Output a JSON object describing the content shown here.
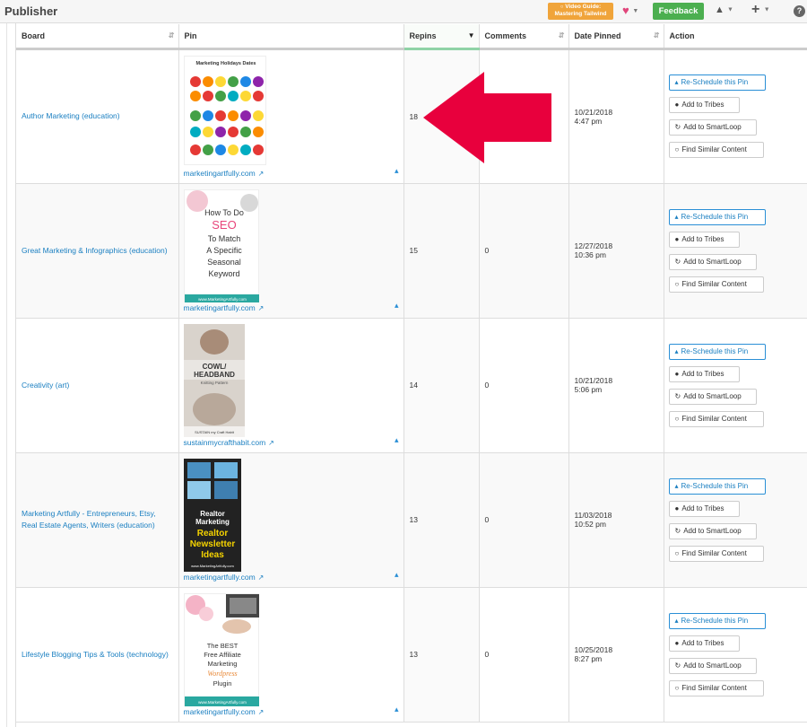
{
  "app": {
    "title": "Publisher",
    "video_guide_line1": "Video Guide:",
    "video_guide_line2": "Mastering Tailwind",
    "feedback_label": "Feedback"
  },
  "table": {
    "headers": {
      "board": "Board",
      "pin": "Pin",
      "repins": "Repins",
      "comments": "Comments",
      "date_pinned": "Date Pinned",
      "action": "Action"
    },
    "sorted_column": "repins",
    "rows": [
      {
        "board": "Author Marketing (education)",
        "domain": "marketingartfully.com",
        "repins": "18",
        "comments": "",
        "date": "10/21/2018",
        "time": "4:47 pm",
        "pin_text": "Marketing Holidays Dates"
      },
      {
        "board": "Great Marketing & Infographics (education)",
        "domain": "marketingartfully.com",
        "repins": "15",
        "comments": "0",
        "date": "12/27/2018",
        "time": "10:36 pm",
        "pin_text": "How To Do SEO To Match A Specific Seasonal Keyword",
        "pin_footer": "www.MarketingArtfully.com"
      },
      {
        "board": "Creativity (art)",
        "domain": "sustainmycrafthabit.com",
        "repins": "14",
        "comments": "0",
        "date": "10/21/2018",
        "time": "5:06 pm",
        "pin_text": "COWL/ HEADBAND",
        "pin_sub": "Knitting Pattern",
        "pin_footer": "SUSTAIN my Craft Habit"
      },
      {
        "board": "Marketing Artfully - Entrepreneurs, Etsy, Real Estate Agents, Writers (education)",
        "domain": "marketingartfully.com",
        "repins": "13",
        "comments": "0",
        "date": "11/03/2018",
        "time": "10:52 pm",
        "pin_text": "Realtor Marketing",
        "pin_text2": "Realtor Newsletter Ideas",
        "pin_footer": "www.MarketingArtfully.com"
      },
      {
        "board": "Lifestyle Blogging Tips & Tools (technology)",
        "domain": "marketingartfully.com",
        "repins": "13",
        "comments": "0",
        "date": "10/25/2018",
        "time": "8:27 pm",
        "pin_text": "The BEST Free Affiliate Marketing",
        "pin_text2": "Wordpress",
        "pin_text3": "Plugin",
        "pin_footer": "www.MarketingArtfully.com"
      }
    ],
    "actions": {
      "reschedule": "Re-Schedule this Pin",
      "tribes": "Add to Tribes",
      "smartloop": "Add to SmartLoop",
      "similar": "Find Similar Content"
    }
  },
  "colors": {
    "accent_link": "#1a7fc1",
    "feedback_green": "#4caf50",
    "video_orange": "#f0a43a",
    "arrow_red": "#e8003d",
    "sorted_header": "#8fd3a6"
  },
  "icons": [
    "heart-icon",
    "bell-icon",
    "plus-icon",
    "help-icon",
    "sort-icon",
    "external-link-icon",
    "tailwind-icon",
    "tribes-icon",
    "smartloop-icon",
    "lightbulb-icon"
  ]
}
